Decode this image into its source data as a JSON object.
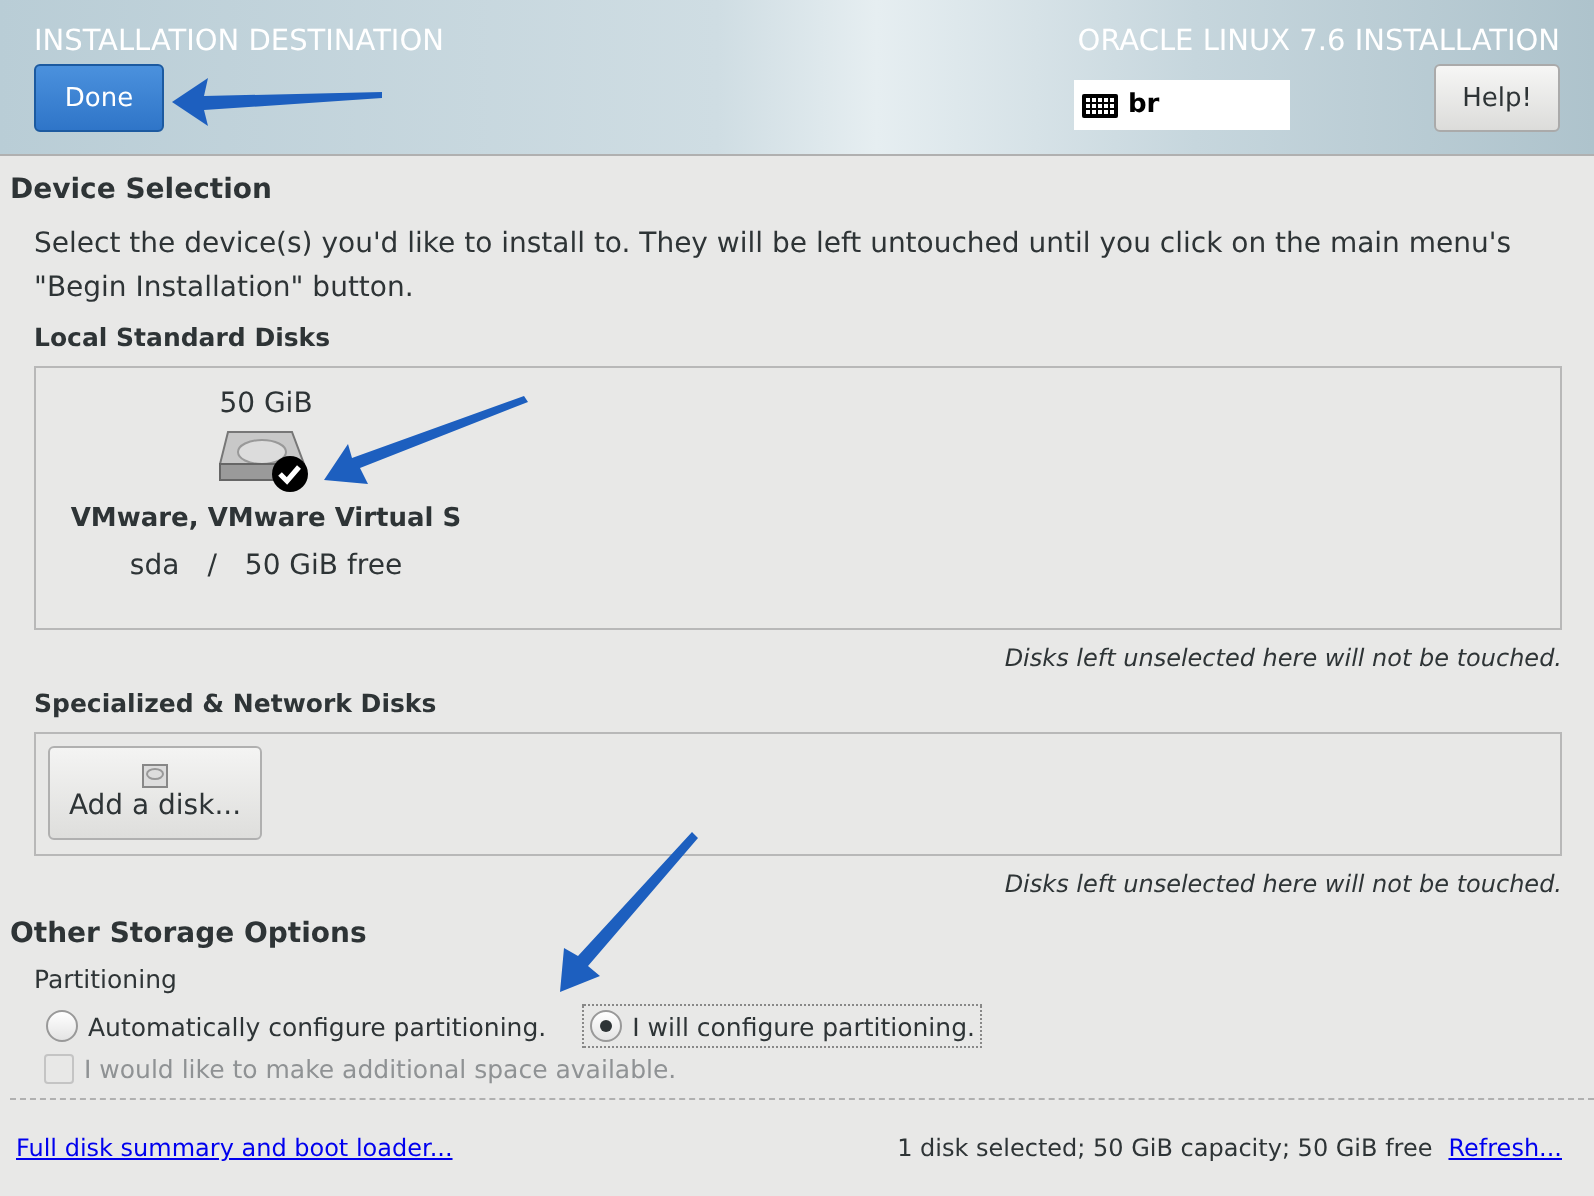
{
  "header": {
    "title": "INSTALLATION DESTINATION",
    "done_button": "Done",
    "product": "ORACLE LINUX 7.6 INSTALLATION",
    "keyboard_layout": "br",
    "help_button": "Help!"
  },
  "device_selection": {
    "heading": "Device Selection",
    "intro": "Select the device(s) you'd like to install to.  They will be left untouched until you click on the main menu's \"Begin Installation\" button.",
    "local_disks": {
      "label": "Local Standard Disks",
      "disks": [
        {
          "size": "50 GiB",
          "name": "VMware, VMware Virtual S",
          "device": "sda",
          "separator": "/",
          "free": "50 GiB free",
          "selected": true
        }
      ],
      "note": "Disks left unselected here will not be touched."
    },
    "network_disks": {
      "label": "Specialized & Network Disks",
      "add_button": "Add a disk...",
      "note": "Disks left unselected here will not be touched."
    }
  },
  "other_storage": {
    "heading": "Other Storage Options",
    "partitioning_label": "Partitioning",
    "options": [
      {
        "label": "Automatically configure partitioning.",
        "selected": false
      },
      {
        "label": "I will configure partitioning.",
        "selected": true
      }
    ],
    "additional_space": {
      "label": "I would like to make additional space available.",
      "checked": false,
      "disabled": true
    }
  },
  "footer": {
    "summary_link": "Full disk summary and boot loader...",
    "status": "1 disk selected; 50 GiB capacity; 50 GiB free",
    "refresh_link": "Refresh..."
  }
}
